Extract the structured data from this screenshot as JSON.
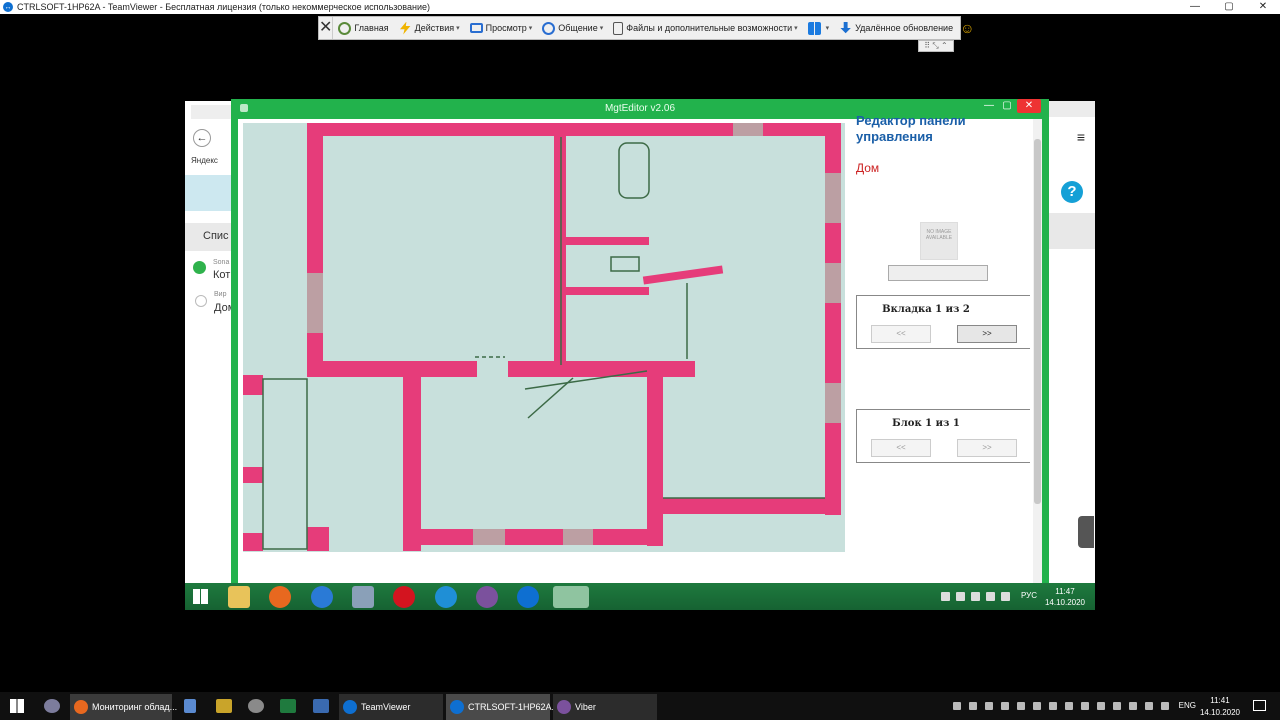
{
  "tv_window": {
    "title": "CTRLSOFT-1HP62A - TeamViewer - Бесплатная лицензия (только некоммерческое использование)",
    "min": "—",
    "max": "▢",
    "close": "✕"
  },
  "tv_toolbar": {
    "close_glyph": "✕",
    "items": [
      {
        "label": "Главная",
        "dropdown": false,
        "color": "#5a8a3a"
      },
      {
        "label": "Действия",
        "dropdown": true,
        "color": "#f0b400"
      },
      {
        "label": "Просмотр",
        "dropdown": true,
        "color": "#2a6ed1"
      },
      {
        "label": "Общение",
        "dropdown": true,
        "color": "#2a6ed1"
      },
      {
        "label": "Файлы и дополнительные возможности",
        "dropdown": true,
        "color": "#555"
      },
      {
        "label": "",
        "dropdown": true,
        "color": "#1b7be0"
      },
      {
        "label": "Удалённое обновление",
        "dropdown": false,
        "color": "#1b6fd1"
      }
    ],
    "smile": "☺",
    "sub_glyph": "⠿ ⤡ ⌃"
  },
  "remote_bg": {
    "left_labels": [
      "Яндекс",
      "Спис",
      "Sona",
      "Кот",
      "Вир",
      "Дом"
    ],
    "help": "?",
    "menu": "≡"
  },
  "mgt": {
    "title": "MgtEditor v2.06",
    "panel_title": "Редактор панели управления",
    "subtitle": "Дом",
    "noimage": "NO IMAGE AVAILABLE",
    "tab_pane": {
      "label": "Вкладка  1 из 2",
      "prev": "<<",
      "next": ">>"
    },
    "block_pane": {
      "label": "Блок  1 из 1",
      "prev": "<<",
      "next": ">>"
    }
  },
  "remote_taskbar": {
    "lang": "РУС",
    "time": "11:47",
    "date": "14.10.2020",
    "apps": [
      {
        "name": "file-explorer",
        "color": "#e8c35a"
      },
      {
        "name": "firefox",
        "color": "#e8681f"
      },
      {
        "name": "edge-legacy",
        "color": "#2a7ad6"
      },
      {
        "name": "calculator",
        "color": "#8aa0b8"
      },
      {
        "name": "opera",
        "color": "#d3141f"
      },
      {
        "name": "edge",
        "color": "#1f8fd6"
      },
      {
        "name": "viber",
        "color": "#7b519d"
      },
      {
        "name": "teamviewer",
        "color": "#0e6fd1"
      },
      {
        "name": "mgteditor",
        "color": "#6aa8d8"
      }
    ]
  },
  "local_taskbar": {
    "apps": [
      {
        "label": "Мониторинг облад...",
        "color": "#e8681f"
      },
      {
        "label": "TeamViewer",
        "color": "#0e6fd1"
      },
      {
        "label": "CTRLSOFT-1HP62A...",
        "color": "#0e6fd1"
      },
      {
        "label": "Viber",
        "color": "#7b519d"
      }
    ],
    "lang": "ENG",
    "time": "11:41",
    "date": "14.10.2020"
  }
}
